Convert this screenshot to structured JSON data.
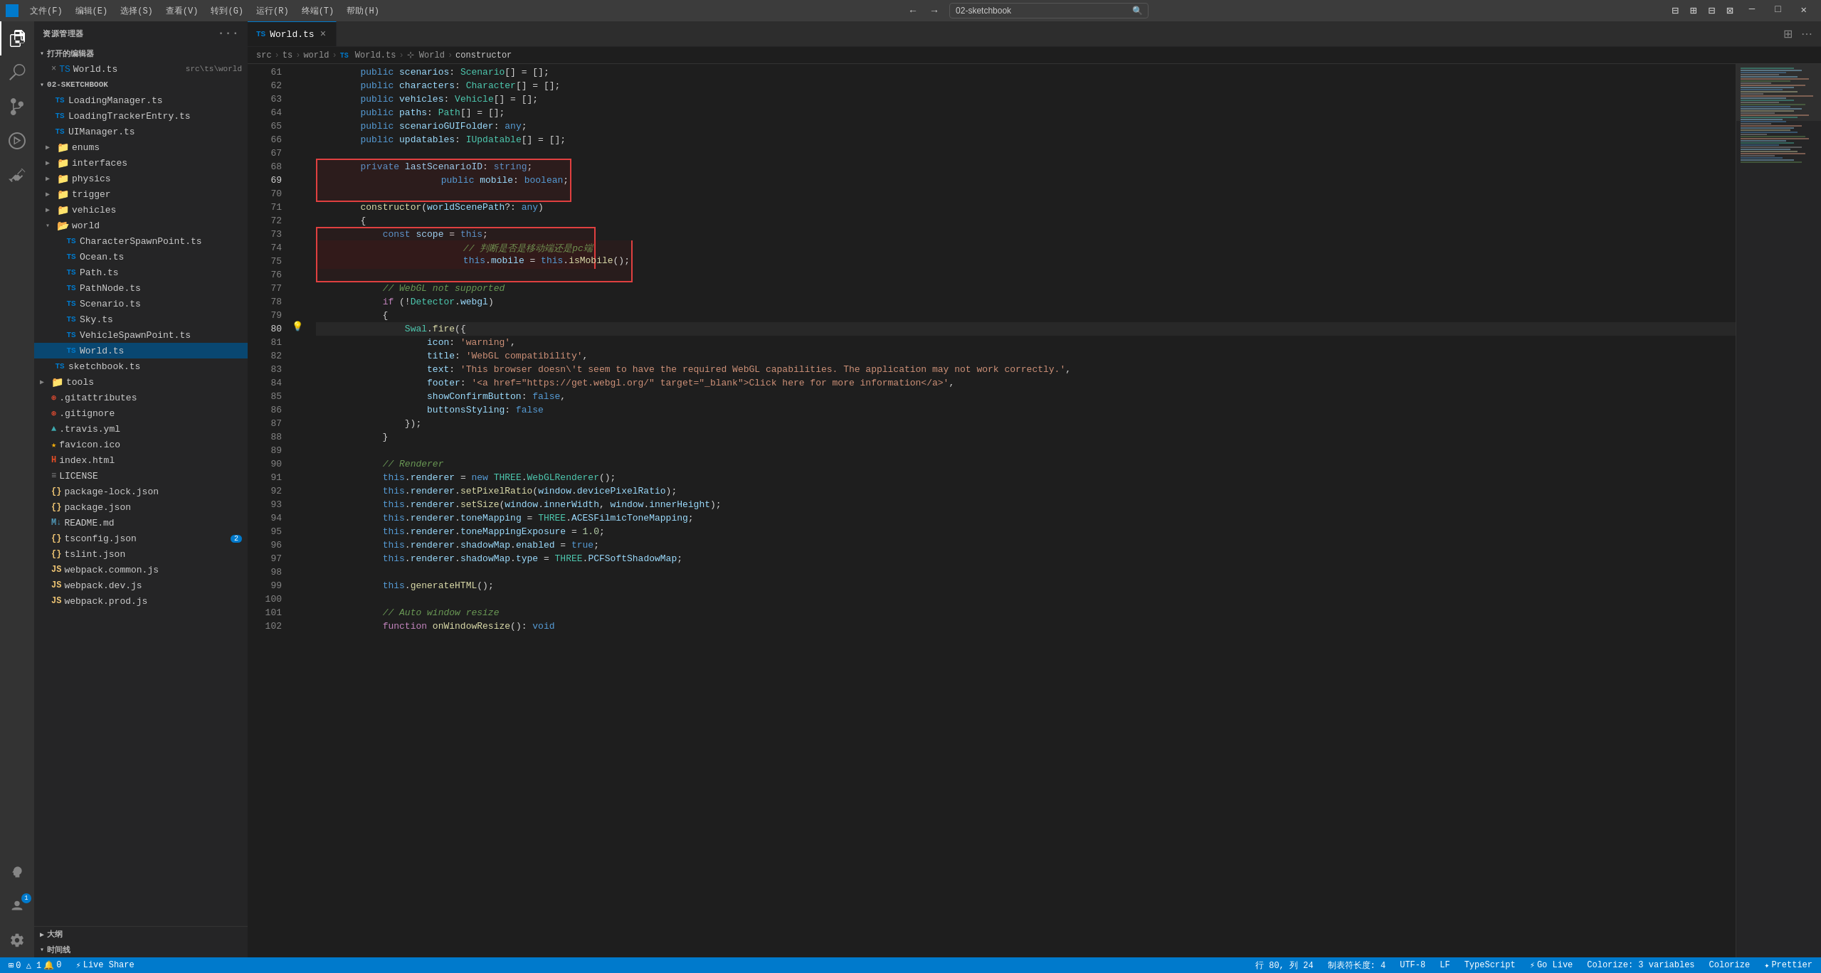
{
  "titlebar": {
    "logo": "◈",
    "menus": [
      "文件(F)",
      "编辑(E)",
      "选择(S)",
      "查看(V)",
      "转到(G)",
      "运行(R)",
      "终端(T)",
      "帮助(H)"
    ],
    "search_value": "02-sketchbook",
    "title": "02-sketchbook",
    "window_controls": [
      "─",
      "□",
      "✕"
    ]
  },
  "activity_bar": {
    "icons": [
      {
        "name": "explorer-icon",
        "symbol": "⎘",
        "active": true
      },
      {
        "name": "search-icon",
        "symbol": "🔍",
        "active": false
      },
      {
        "name": "source-control-icon",
        "symbol": "⑂",
        "active": false
      },
      {
        "name": "run-icon",
        "symbol": "▷",
        "active": false
      },
      {
        "name": "extensions-icon",
        "symbol": "⧉",
        "active": false
      }
    ],
    "bottom_icons": [
      {
        "name": "remote-icon",
        "symbol": "⊞",
        "active": false
      },
      {
        "name": "account-icon",
        "symbol": "👤",
        "badge": "1",
        "active": false
      },
      {
        "name": "settings-icon",
        "symbol": "⚙",
        "active": false
      }
    ]
  },
  "sidebar": {
    "title": "资源管理器",
    "open_editors_label": "打开的编辑器",
    "open_files": [
      {
        "name": "World.ts",
        "path": "src\\ts\\world",
        "active": true,
        "icon": "ts",
        "close": "×"
      }
    ],
    "project_name": "02-SKETCHBOOK",
    "tree": [
      {
        "label": "LoadingManager.ts",
        "indent": 1,
        "type": "ts",
        "has_arrow": false
      },
      {
        "label": "LoadingTrackerEntry.ts",
        "indent": 1,
        "type": "ts",
        "has_arrow": false
      },
      {
        "label": "UIManager.ts",
        "indent": 1,
        "type": "ts",
        "has_arrow": false
      },
      {
        "label": "enums",
        "indent": 1,
        "type": "folder",
        "has_arrow": true,
        "collapsed": true
      },
      {
        "label": "interfaces",
        "indent": 1,
        "type": "folder",
        "has_arrow": true,
        "collapsed": true
      },
      {
        "label": "physics",
        "indent": 1,
        "type": "folder",
        "has_arrow": true,
        "collapsed": true
      },
      {
        "label": "trigger",
        "indent": 1,
        "type": "folder",
        "has_arrow": true,
        "collapsed": true
      },
      {
        "label": "vehicles",
        "indent": 1,
        "type": "folder",
        "has_arrow": true,
        "collapsed": true
      },
      {
        "label": "world",
        "indent": 1,
        "type": "folder_open",
        "has_arrow": true,
        "open": true
      },
      {
        "label": "CharacterSpawnPoint.ts",
        "indent": 2,
        "type": "ts"
      },
      {
        "label": "Ocean.ts",
        "indent": 2,
        "type": "ts"
      },
      {
        "label": "Path.ts",
        "indent": 2,
        "type": "ts"
      },
      {
        "label": "PathNode.ts",
        "indent": 2,
        "type": "ts"
      },
      {
        "label": "Scenario.ts",
        "indent": 2,
        "type": "ts"
      },
      {
        "label": "Sky.ts",
        "indent": 2,
        "type": "ts"
      },
      {
        "label": "VehicleSpawnPoint.ts",
        "indent": 2,
        "type": "ts"
      },
      {
        "label": "World.ts",
        "indent": 2,
        "type": "ts",
        "active": true
      },
      {
        "label": "sketchbook.ts",
        "indent": 1,
        "type": "ts"
      },
      {
        "label": "tools",
        "indent": 0,
        "type": "folder",
        "has_arrow": true,
        "collapsed": true
      },
      {
        "label": ".gitattributes",
        "indent": 0,
        "type": "git"
      },
      {
        "label": ".gitignore",
        "indent": 0,
        "type": "gitignore"
      },
      {
        "label": ".travis.yml",
        "indent": 0,
        "type": "travis"
      },
      {
        "label": "favicon.ico",
        "indent": 0,
        "type": "ico"
      },
      {
        "label": "index.html",
        "indent": 0,
        "type": "html"
      },
      {
        "label": "LICENSE",
        "indent": 0,
        "type": "plain"
      },
      {
        "label": "package-lock.json",
        "indent": 0,
        "type": "json"
      },
      {
        "label": "package.json",
        "indent": 0,
        "type": "json"
      },
      {
        "label": "README.md",
        "indent": 0,
        "type": "md"
      },
      {
        "label": "tsconfig.json",
        "indent": 0,
        "type": "json",
        "badge": "2"
      },
      {
        "label": "tslint.json",
        "indent": 0,
        "type": "json"
      },
      {
        "label": "webpack.common.js",
        "indent": 0,
        "type": "js"
      },
      {
        "label": "webpack.dev.js",
        "indent": 0,
        "type": "js"
      },
      {
        "label": "webpack.prod.js",
        "indent": 0,
        "type": "js"
      }
    ],
    "sections": [
      {
        "label": "大纲",
        "collapsed": true
      },
      {
        "label": "时间线",
        "collapsed": false
      }
    ]
  },
  "editor": {
    "tab": {
      "label": "World.ts",
      "icon": "ts"
    },
    "breadcrumb": [
      "src",
      ">",
      "ts",
      ">",
      "world",
      ">",
      "World.ts",
      ">",
      "⊹ World",
      ">",
      "constructor"
    ],
    "lines": [
      {
        "num": 61,
        "content": "        public scenarios: Scenario[] = [];"
      },
      {
        "num": 62,
        "content": "        public characters: Character[] = [];"
      },
      {
        "num": 63,
        "content": "        public vehicles: Vehicle[] = [];"
      },
      {
        "num": 64,
        "content": "        public paths: Path[] = [];"
      },
      {
        "num": 65,
        "content": "        public scenarioGUIFolder: any;"
      },
      {
        "num": 66,
        "content": "        public updatables: IUpdatable[] = [];"
      },
      {
        "num": 67,
        "content": ""
      },
      {
        "num": 68,
        "content": "        private lastScenarioID: string;"
      },
      {
        "num": 69,
        "content": "        public mobile: boolean;",
        "highlight": "red"
      },
      {
        "num": 70,
        "content": ""
      },
      {
        "num": 71,
        "content": "        constructor(worldScenePath?: any)"
      },
      {
        "num": 72,
        "content": "        {"
      },
      {
        "num": 73,
        "content": "            const scope = this;"
      },
      {
        "num": 74,
        "content": "            // 判断是否是移动端还是pc端",
        "highlight_block_start": true
      },
      {
        "num": 75,
        "content": "            this.mobile = this.isMobile();",
        "highlight_block_end": true
      },
      {
        "num": 76,
        "content": ""
      },
      {
        "num": 77,
        "content": "            // WebGL not supported"
      },
      {
        "num": 78,
        "content": "            if (!Detector.webgl)"
      },
      {
        "num": 79,
        "content": "            {"
      },
      {
        "num": 80,
        "content": "                Swal.fire({",
        "gutter_icon": "💡"
      },
      {
        "num": 81,
        "content": "                    icon: 'warning',"
      },
      {
        "num": 82,
        "content": "                    title: 'WebGL compatibility',"
      },
      {
        "num": 83,
        "content": "                    text: 'This browser doesn\\'t seem to have the required WebGL capabilities. The application may not work correctly.',"
      },
      {
        "num": 84,
        "content": "                    footer: '<a href=\"https://get.webgl.org/\" target=\"_blank\">Click here for more information</a>',"
      },
      {
        "num": 85,
        "content": "                    showConfirmButton: false,"
      },
      {
        "num": 86,
        "content": "                    buttonsStyling: false"
      },
      {
        "num": 87,
        "content": "                });"
      },
      {
        "num": 88,
        "content": "            }"
      },
      {
        "num": 89,
        "content": ""
      },
      {
        "num": 90,
        "content": "            // Renderer"
      },
      {
        "num": 91,
        "content": "            this.renderer = new THREE.WebGLRenderer();"
      },
      {
        "num": 92,
        "content": "            this.renderer.setPixelRatio(window.devicePixelRatio);"
      },
      {
        "num": 93,
        "content": "            this.renderer.setSize(window.innerWidth, window.innerHeight);"
      },
      {
        "num": 94,
        "content": "            this.renderer.toneMapping = THREE.ACESFilmicToneMapping;"
      },
      {
        "num": 95,
        "content": "            this.renderer.toneMappingExposure = 1.0;"
      },
      {
        "num": 96,
        "content": "            this.renderer.shadowMap.enabled = true;"
      },
      {
        "num": 97,
        "content": "            this.renderer.shadowMap.type = THREE.PCFSoftShadowMap;"
      },
      {
        "num": 98,
        "content": ""
      },
      {
        "num": 99,
        "content": "            this.generateHTML();"
      },
      {
        "num": 100,
        "content": ""
      },
      {
        "num": 101,
        "content": "            // Auto window resize"
      },
      {
        "num": 102,
        "content": "            function onWindowResize(): void"
      }
    ]
  },
  "status_bar": {
    "left": [
      {
        "label": "⊞ 0 △ 1  🔔 0",
        "name": "source-control-status"
      },
      {
        "label": "⚡ Live Share",
        "name": "live-share-status"
      }
    ],
    "right": [
      {
        "label": "行 80, 列 24",
        "name": "cursor-position"
      },
      {
        "label": "制表符长度: 4",
        "name": "tab-size"
      },
      {
        "label": "UTF-8",
        "name": "encoding"
      },
      {
        "label": "LF",
        "name": "eol"
      },
      {
        "label": "TypeScript",
        "name": "language-mode"
      },
      {
        "label": "⚡ Go Live",
        "name": "go-live"
      },
      {
        "label": "Colorize: 3 variables",
        "name": "colorize"
      },
      {
        "label": "Colorize",
        "name": "colorize-btn"
      },
      {
        "label": "✦ Prettier",
        "name": "prettier-btn"
      }
    ]
  }
}
